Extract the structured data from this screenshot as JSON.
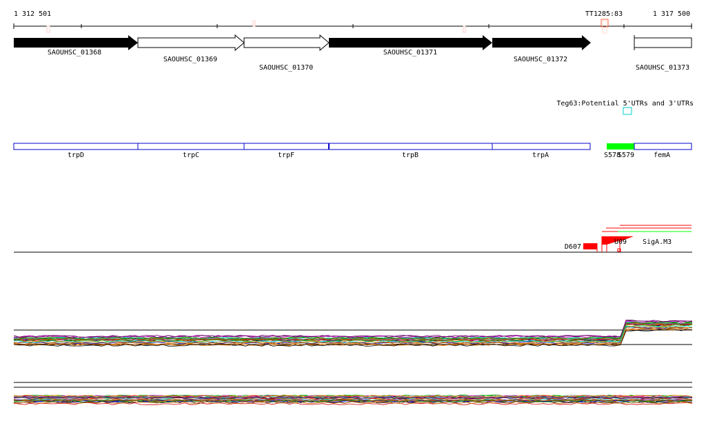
{
  "ruler": {
    "start": "1 312 501",
    "end": "1 317 500",
    "marker": "TT1285:83"
  },
  "genes": [
    {
      "label": "SAOUHSC_01368",
      "filled": true
    },
    {
      "label": "SAOUHSC_01369",
      "filled": false
    },
    {
      "label": "SAOUHSC_01370",
      "filled": false
    },
    {
      "label": "SAOUHSC_01371",
      "filled": true
    },
    {
      "label": "SAOUHSC_01372",
      "filled": true
    },
    {
      "label": "SAOUHSC_01373",
      "filled": false
    }
  ],
  "utr_track": {
    "label": "Teg63:Potential 5'UTRs and 3'UTRs"
  },
  "operons": [
    {
      "label": "trpD"
    },
    {
      "label": "trpC"
    },
    {
      "label": "trpF"
    },
    {
      "label": "trpB"
    },
    {
      "label": "trpA"
    },
    {
      "label": "S578"
    },
    {
      "label": "S579"
    },
    {
      "label": "femA"
    }
  ],
  "features": {
    "d607": "D607",
    "overlap_a": "U09",
    "overlap_b": "SigA.M3"
  },
  "colors": {
    "red": "#ff0000",
    "green": "#00ff00",
    "blue": "#0000cc",
    "cyan": "#00cccc"
  }
}
